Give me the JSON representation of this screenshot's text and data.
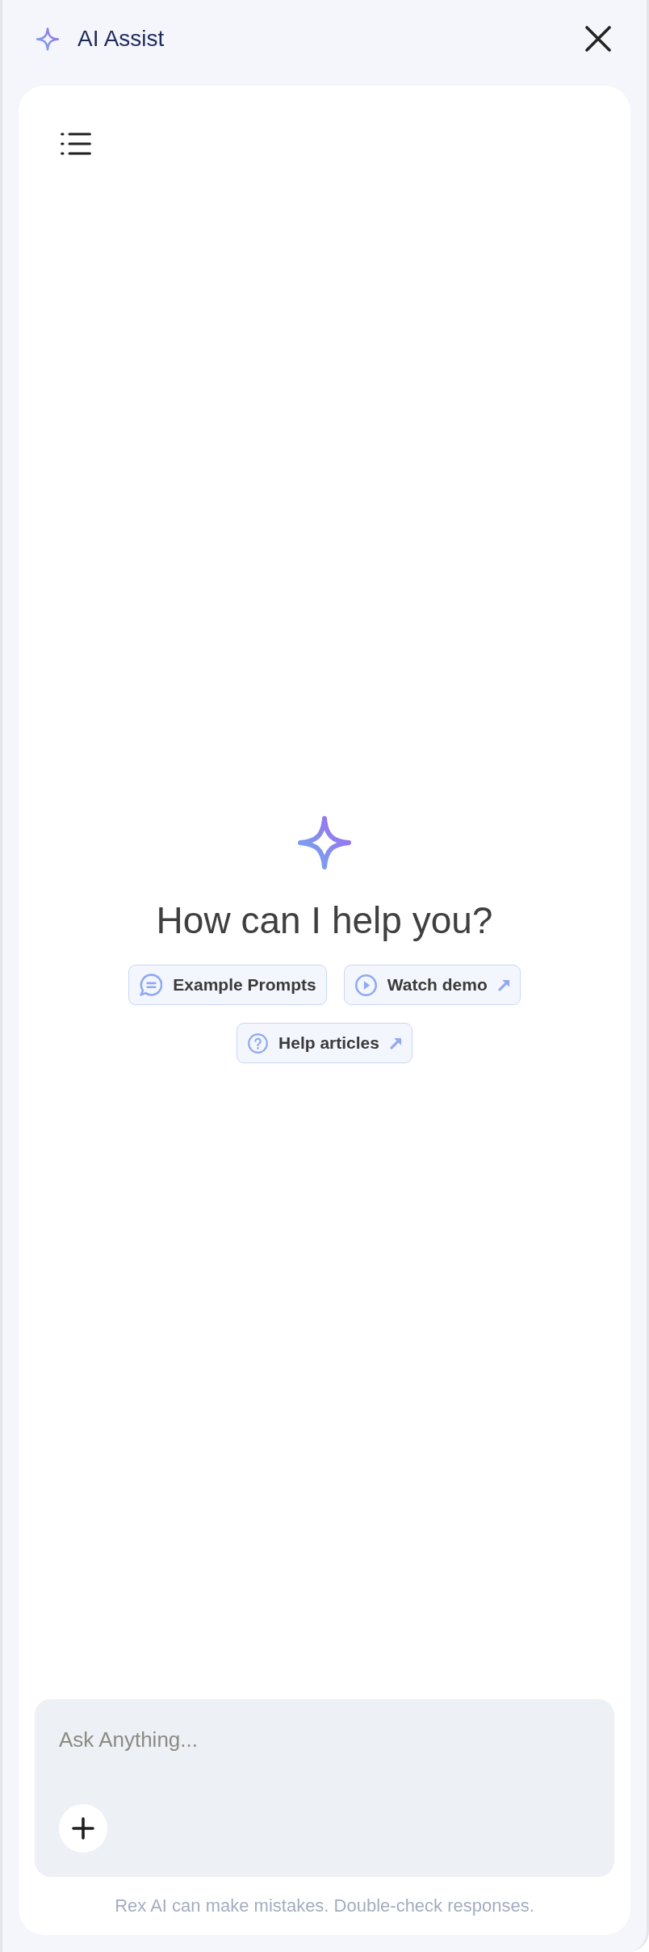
{
  "header": {
    "title": "AI Assist"
  },
  "welcome": {
    "heading": "How can I help you?"
  },
  "quick_actions": [
    {
      "kind": "prompts",
      "label": "Example Prompts",
      "external": false
    },
    {
      "kind": "demo",
      "label": "Watch demo",
      "external": true
    },
    {
      "kind": "help",
      "label": "Help articles",
      "external": true
    }
  ],
  "composer": {
    "placeholder": "Ask Anything..."
  },
  "disclaimer": "Rex AI can make mistakes. Double-check responses."
}
